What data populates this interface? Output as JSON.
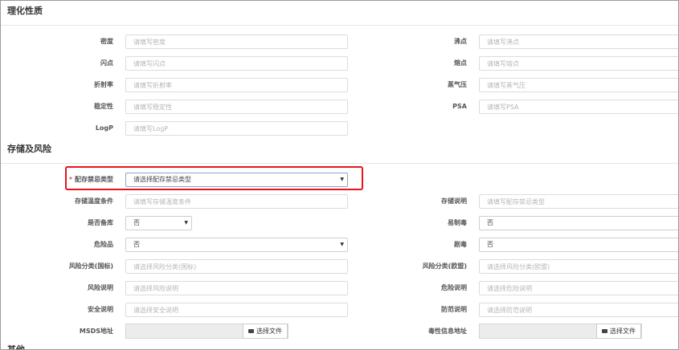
{
  "sections": {
    "physicochemical": "理化性质",
    "storage": "存储及风险",
    "other": "其他"
  },
  "physicochemical": {
    "density": {
      "label": "密度",
      "placeholder": "请填写密度"
    },
    "flash_point": {
      "label": "闪点",
      "placeholder": "请填写闪点"
    },
    "refractive_index": {
      "label": "折射率",
      "placeholder": "请填写折射率"
    },
    "stability": {
      "label": "稳定性",
      "placeholder": "请填写稳定性"
    },
    "logp": {
      "label": "LogP",
      "placeholder": "请填写LogP"
    },
    "boiling_point": {
      "label": "沸点",
      "placeholder": "请填写沸点"
    },
    "melting_point": {
      "label": "熔点",
      "placeholder": "请填写熔点"
    },
    "vapor_pressure": {
      "label": "蒸气压",
      "placeholder": "请填写蒸气压"
    },
    "psa": {
      "label": "PSA",
      "placeholder": "请填写PSA"
    }
  },
  "storage": {
    "storage_type": {
      "label": "配存禁忌类型",
      "required_mark": "*",
      "value": "请选择配存禁忌类型"
    },
    "storage_temp": {
      "label": "存储温度条件",
      "placeholder": "请填写存储温度条件"
    },
    "storage_note": {
      "label": "存储说明",
      "placeholder": "请填写配存禁忌类型"
    },
    "is_prepared": {
      "label": "是否备库",
      "value": "否"
    },
    "precursor": {
      "label": "易制毒",
      "value": "否"
    },
    "hazardous": {
      "label": "危险品",
      "value": "否"
    },
    "toxic": {
      "label": "剧毒",
      "value": "否"
    },
    "risk_class_intl": {
      "label": "风险分类(国标)",
      "placeholder": "请选择风险分类(国标)"
    },
    "risk_class_eu": {
      "label": "风险分类(欧盟)",
      "placeholder": "请选择风险分类(欧盟)"
    },
    "risk_note": {
      "label": "风险说明",
      "placeholder": "请选择风险说明"
    },
    "hazard_note": {
      "label": "危险说明",
      "placeholder": "请选择危险说明"
    },
    "safety_note": {
      "label": "安全说明",
      "placeholder": "请选择安全说明"
    },
    "precaution_note": {
      "label": "防范说明",
      "placeholder": "请选择防范说明"
    },
    "msds": {
      "label": "MSDS地址",
      "button": "选择文件"
    },
    "toxicity_info": {
      "label": "毒性信息地址",
      "button": "选择文件"
    }
  },
  "icons": {
    "caret": "caret-down-icon",
    "folder": "folder-open-icon"
  },
  "colors": {
    "highlight": "#e8141b",
    "required": "#d9534f"
  }
}
